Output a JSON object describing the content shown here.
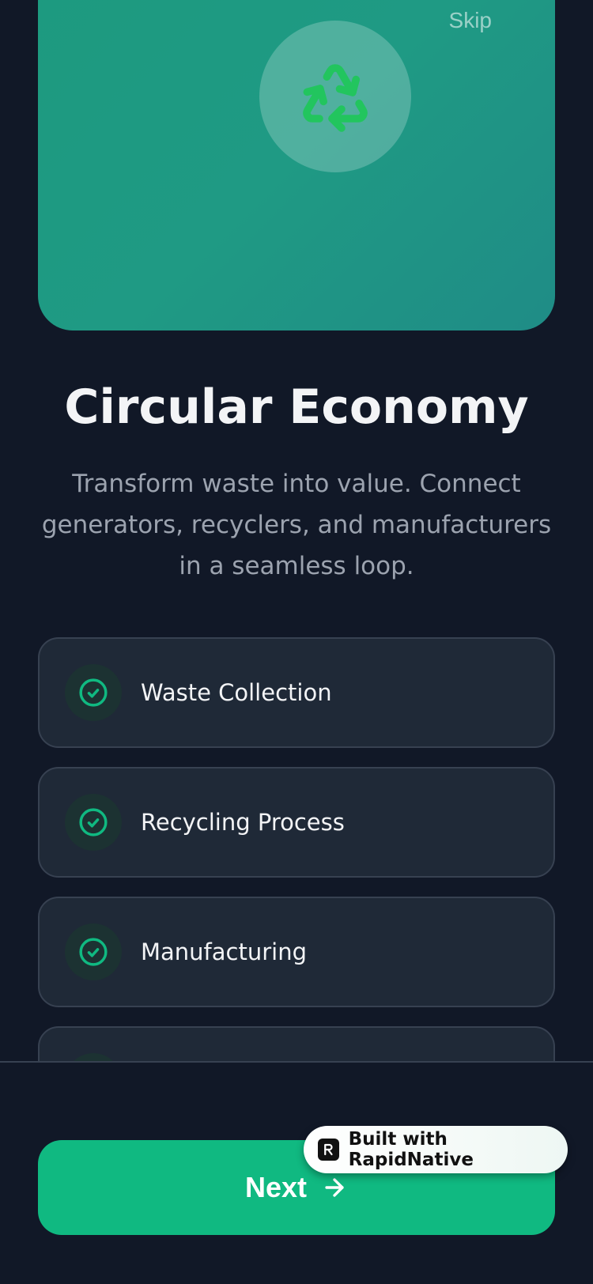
{
  "hero": {
    "skip_label": "Skip",
    "icon": "recycle-icon",
    "icon_color": "#22c55e"
  },
  "content": {
    "title": "Circular Economy",
    "subtitle": "Transform waste into value. Connect generators, recyclers, and manufacturers in a seamless loop."
  },
  "features": [
    {
      "label": "Waste Collection",
      "icon": "check-circle-icon"
    },
    {
      "label": "Recycling Process",
      "icon": "check-circle-icon"
    },
    {
      "label": "Manufacturing",
      "icon": "check-circle-icon"
    },
    {
      "label": "",
      "icon": "check-circle-icon"
    }
  ],
  "footer": {
    "next_label": "Next",
    "next_icon": "arrow-right-icon"
  },
  "badge": {
    "text": "Built with RapidNative"
  },
  "colors": {
    "background": "#111827",
    "accent": "#10b981",
    "card": "#1f2937",
    "card_border": "#374151",
    "hero_gradient_start": "#1d9a7f",
    "hero_gradient_end": "#1f8c86"
  }
}
